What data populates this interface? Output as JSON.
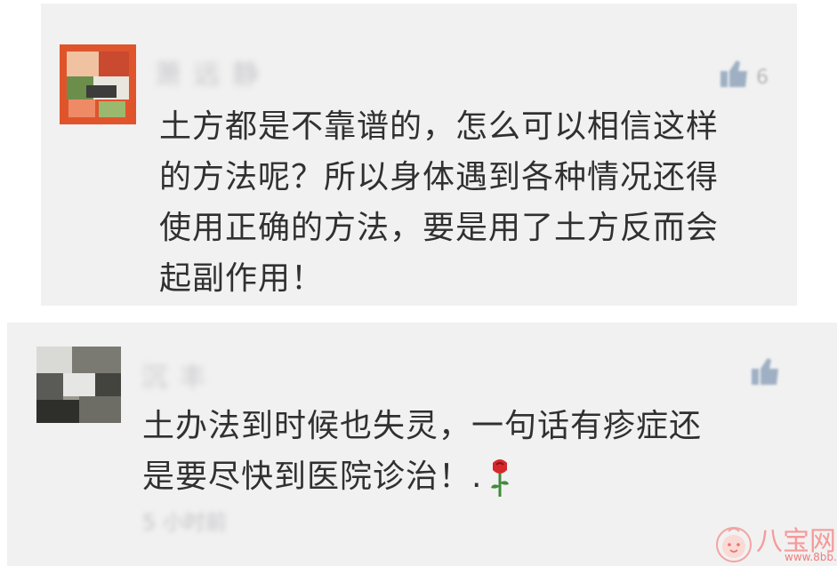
{
  "comments": [
    {
      "username": "萧 远 静",
      "lines": [
        "土方都是不靠谱的，怎么可以相信这样",
        "的方法呢？所以身体遇到各种情况还得",
        "使用正确的方法，要是用了土方反而会",
        "起副作用！"
      ],
      "like_icon": "thumbs-up-icon",
      "like_count": "6"
    },
    {
      "username": "沉 丰",
      "lines": [
        "土办法到时候也失灵，一句话有疹症还",
        "是要尽快到医院诊治！."
      ],
      "emoji": "rose-icon",
      "like_icon": "thumbs-up-icon",
      "timestamp": "5 小时前"
    }
  ],
  "watermark": {
    "brand": "八宝网",
    "url": "www.8bb.com",
    "brand_color": "#f07c7c"
  },
  "colors": {
    "card_background": "#f1f1f1",
    "text": "#303030",
    "blurred_text": "#c8c8cc"
  }
}
